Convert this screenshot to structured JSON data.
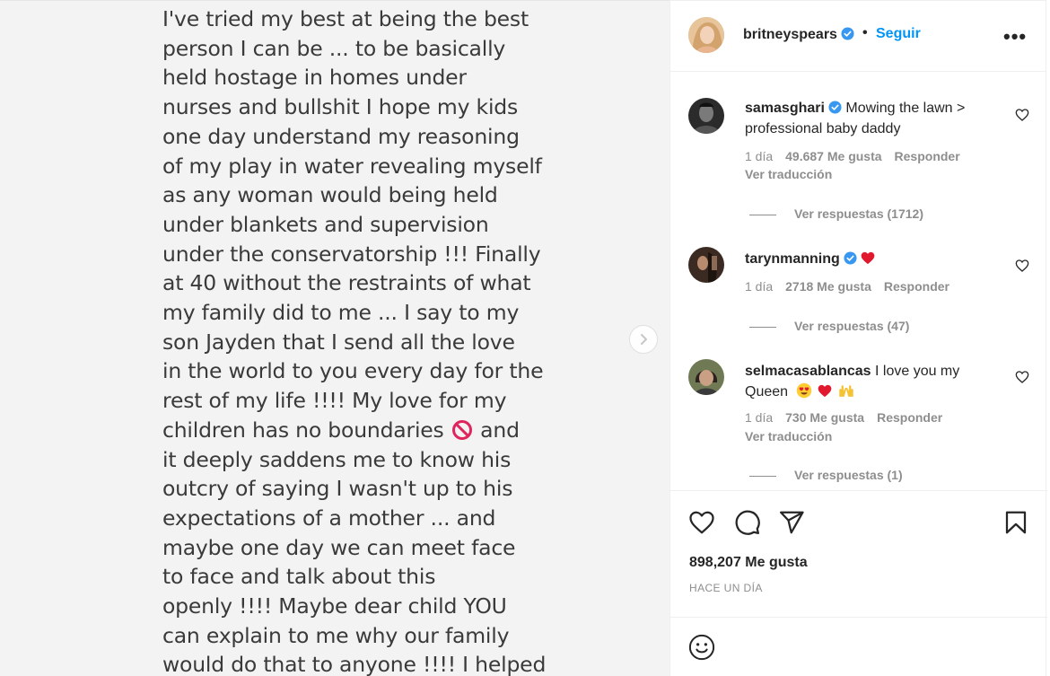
{
  "post": {
    "text_lines": [
      "I've tried my best at being the best",
      "person I can be ... to be basically",
      "held hostage in homes under",
      "nurses and bullshit I hope my kids",
      "one day understand my reasoning",
      "of my play in water revealing myself",
      "as any woman would being held",
      "under blankets and supervision",
      "under the conservatorship !!! Finally",
      "at 40 without the restraints of what",
      "my family did to me ... I say to my",
      "son Jayden that I send all the love",
      "in the world to you every day for the",
      "rest of my life !!!! My love for my",
      "children has no boundaries",
      "and",
      "it deeply saddens me to know his",
      "outcry of saying I wasn't up to his",
      "expectations of a mother ... and",
      "maybe one day we can meet face",
      "to face and talk about this",
      "openly !!!! Maybe dear child YOU",
      "can explain to me why our family",
      "would do that to anyone !!!! I helped"
    ]
  },
  "header": {
    "username": "britneyspears",
    "dot": "•",
    "follow_label": "Seguir",
    "more_label": "•••"
  },
  "comments": [
    {
      "username": "samasghari",
      "text": "Mowing the lawn > professional baby daddy",
      "age": "1 día",
      "likes": "49.687 Me gusta",
      "reply_label": "Responder",
      "translate_label": "Ver traducción",
      "replies_label": "Ver respuestas (1712)"
    },
    {
      "username": "tarynmanning",
      "text": "",
      "age": "1 día",
      "likes": "2718 Me gusta",
      "reply_label": "Responder",
      "replies_label": "Ver respuestas (47)"
    },
    {
      "username": "selmacasablancas",
      "text": "I love you my Queen",
      "age": "1 día",
      "likes": "730 Me gusta",
      "reply_label": "Responder",
      "translate_label": "Ver traducción",
      "replies_label": "Ver respuestas (1)"
    }
  ],
  "footer": {
    "likes_count": "898,207 Me gusta",
    "timestamp": "HACE UN DÍA"
  },
  "icons": {
    "next": "chevron-right-icon",
    "verified": "verified-badge-icon",
    "like": "heart-icon",
    "comment": "comment-icon",
    "share": "send-icon",
    "save": "bookmark-icon",
    "emoji": "smiley-icon"
  },
  "colors": {
    "link_blue": "#0095f6",
    "verified_blue": "#3897f0",
    "muted": "#8e8e8e",
    "heart_red": "#ed4956"
  }
}
